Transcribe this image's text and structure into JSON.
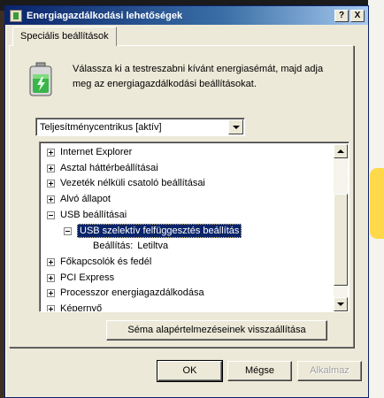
{
  "window": {
    "title": "Energiagazdálkodási lehetőségek",
    "help_label": "?",
    "close_label": "X"
  },
  "tab": {
    "label": "Speciális beállítások"
  },
  "intro_text": "Válassza ki a testreszabni kívánt energiasémát, majd adja meg az energiagazdálkodási beállításokat.",
  "plan_select": {
    "value": "Teljesítménycentrikus [aktív]"
  },
  "tree": {
    "items": [
      {
        "label": "Internet Explorer",
        "toggle": "plus",
        "level": 0
      },
      {
        "label": "Asztal háttérbeállításai",
        "toggle": "plus",
        "level": 0
      },
      {
        "label": "Vezeték nélküli csatoló beállításai",
        "toggle": "plus",
        "level": 0
      },
      {
        "label": "Alvó állapot",
        "toggle": "plus",
        "level": 0
      },
      {
        "label": "USB beállításai",
        "toggle": "minus",
        "level": 0
      },
      {
        "label": "USB szelektív felfüggesztés beállítás",
        "toggle": "minus",
        "level": 1,
        "selected": true
      },
      {
        "label": "Beállítás:",
        "value": "Letiltva",
        "toggle": "none",
        "level": 2
      },
      {
        "label": "Főkapcsolók és fedél",
        "toggle": "plus",
        "level": 0
      },
      {
        "label": "PCI Express",
        "toggle": "plus",
        "level": 0
      },
      {
        "label": "Processzor energiagazdálkodása",
        "toggle": "plus",
        "level": 0
      },
      {
        "label": "Képernyő",
        "toggle": "plus",
        "level": 0
      }
    ]
  },
  "buttons": {
    "restore": "Séma alapértelmezéseinek visszaállítása",
    "ok": "OK",
    "cancel": "Mégse",
    "apply": "Alkalmaz"
  },
  "colors": {
    "selection": "#0a246a",
    "face": "#ece9d8"
  }
}
